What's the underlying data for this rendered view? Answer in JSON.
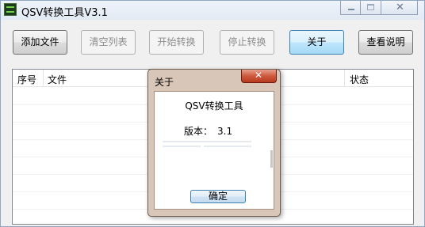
{
  "window": {
    "title": "QSV转换工具V3.1",
    "icon": "app-icon"
  },
  "toolbar": {
    "add_file": "添加文件",
    "clear_list": "清空列表",
    "start_convert": "开始转换",
    "stop_convert": "停止转换",
    "about": "关于",
    "help": "查看说明"
  },
  "list": {
    "columns": [
      "序号",
      "文件",
      "状态"
    ]
  },
  "about_dialog": {
    "title": "关于",
    "app_name": "QSV转换工具",
    "version_label": "版本：",
    "version_value": "3.1",
    "ok": "确定"
  },
  "colors": {
    "dialog_frame": "#d8c6b8",
    "close_button": "#cd5a3e",
    "focus_border": "#3c7fb1"
  }
}
